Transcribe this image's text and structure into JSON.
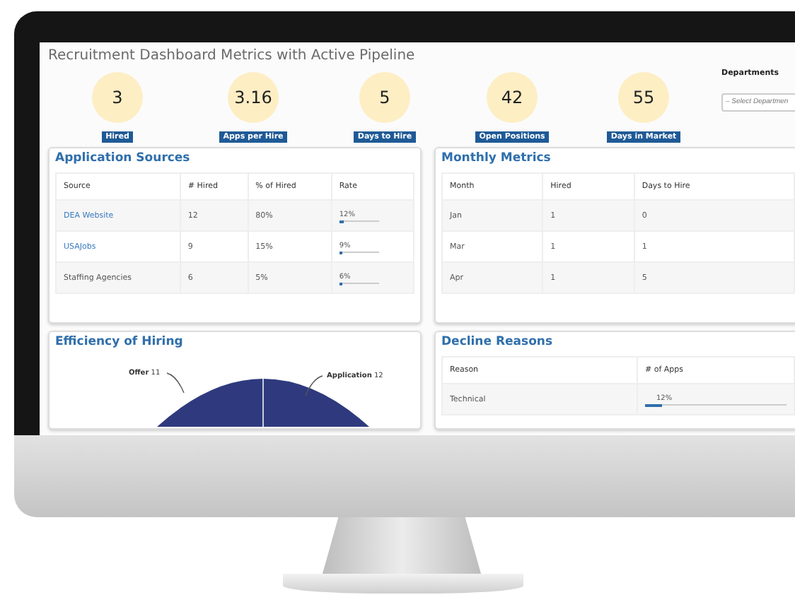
{
  "dashboard": {
    "title": "Recruitment Dashboard Metrics with Active Pipeline",
    "metrics": [
      {
        "value": "3",
        "label": "Hired"
      },
      {
        "value": "3.16",
        "label": "Apps per Hire"
      },
      {
        "value": "5",
        "label": "Days to Hire"
      },
      {
        "value": "42",
        "label": "Open Positions"
      },
      {
        "value": "55",
        "label": "Days in Market"
      }
    ],
    "departments": {
      "label": "Departments",
      "placeholder": "– Select Departmen"
    },
    "application_sources": {
      "title": "Application Sources",
      "columns": [
        "Source",
        "# Hired",
        "% of Hired",
        "Rate"
      ],
      "rows": [
        {
          "source": "DEA Website",
          "link": true,
          "hired": "12",
          "percent": "80%",
          "rate": "12%",
          "level": 0.12
        },
        {
          "source": "USAJobs",
          "link": true,
          "hired": "9",
          "percent": "15%",
          "rate": "9%",
          "level": 0.09
        },
        {
          "source": "Staffing Agencies",
          "link": false,
          "hired": "6",
          "percent": "5%",
          "rate": "6%",
          "level": 0.06
        }
      ]
    },
    "monthly_metrics": {
      "title": "Monthly Metrics",
      "columns": [
        "Month",
        "Hired",
        "Days to Hire"
      ],
      "rows": [
        {
          "month": "Jan",
          "hired": "1",
          "days": "0"
        },
        {
          "month": "Mar",
          "hired": "1",
          "days": "1"
        },
        {
          "month": "Apr",
          "hired": "1",
          "days": "5"
        }
      ]
    },
    "efficiency": {
      "title": "Efficiency of Hiring",
      "labels": [
        {
          "name": "Offer",
          "value": "11"
        },
        {
          "name": "Application",
          "value": "12"
        }
      ]
    },
    "decline_reasons": {
      "title": "Decline Reasons",
      "columns": [
        "Reason",
        "# of Apps"
      ],
      "rows": [
        {
          "reason": "Technical",
          "rate": "12%",
          "level": 0.12
        }
      ]
    }
  }
}
